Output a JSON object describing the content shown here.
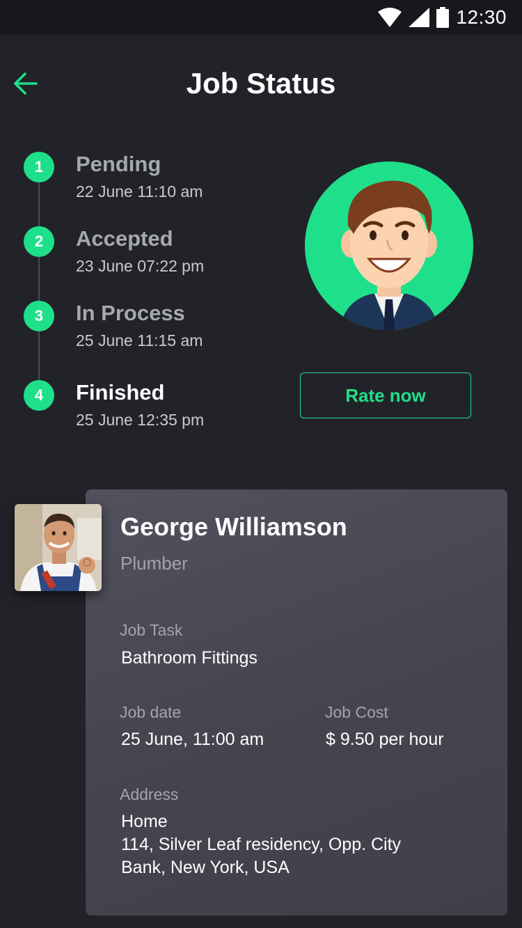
{
  "status_bar": {
    "time": "12:30",
    "icons": [
      "wifi-icon",
      "signal-icon",
      "battery-icon"
    ]
  },
  "header": {
    "title": "Job Status",
    "back_icon": "arrow-left-icon"
  },
  "colors": {
    "accent": "#1fe08a",
    "background": "#222328",
    "card": "#4a4a55",
    "status_bar": "#17181c"
  },
  "timeline": {
    "steps": [
      {
        "number": "1",
        "label": "Pending",
        "time": "22 June 11:10 am"
      },
      {
        "number": "2",
        "label": "Accepted",
        "time": "23 June 07:22 pm"
      },
      {
        "number": "3",
        "label": "In Process",
        "time": "25 June 11:15 am"
      },
      {
        "number": "4",
        "label": "Finished",
        "time": "25 June 12:35 pm"
      }
    ]
  },
  "rate_button": {
    "label": "Rate now"
  },
  "worker": {
    "name": "George Williamson",
    "role": "Plumber",
    "job_task": {
      "label": "Job Task",
      "value": "Bathroom Fittings"
    },
    "job_date": {
      "label": "Job date",
      "value": "25 June, 11:00 am"
    },
    "job_cost": {
      "label": "Job Cost",
      "value": "$ 9.50 per hour"
    },
    "address": {
      "label": "Address",
      "lines": [
        "Home",
        "114, Silver Leaf residency, Opp. City",
        "Bank, New York, USA"
      ]
    }
  }
}
